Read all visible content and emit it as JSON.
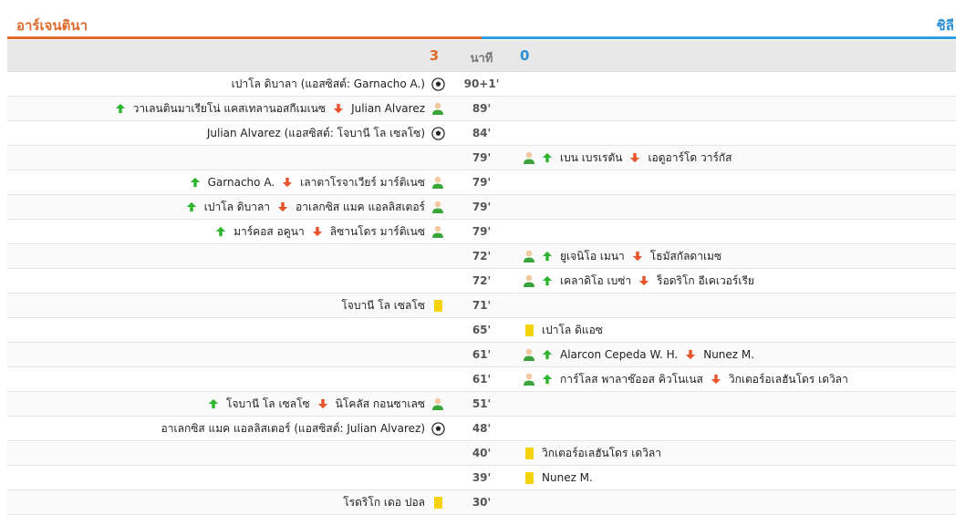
{
  "teams": {
    "home": "อาร์เจนตินา",
    "away": "ชิลี"
  },
  "score": {
    "home": "3",
    "away": "0"
  },
  "minute_header": "นาที",
  "colors": {
    "home": "#e06a2c",
    "away": "#2d8fd5",
    "arrow_in": "#2db52d",
    "arrow_out": "#e8532b",
    "card": "#f5d20a"
  },
  "events": [
    {
      "minute": "90+1'",
      "side": "home",
      "type": "goal",
      "text": "เปาโล ดิบาลา (แอสซิสต์: Garnacho A.)"
    },
    {
      "minute": "89'",
      "side": "home",
      "type": "sub",
      "in": "วาเลนตินมาเรียโน่ แคสเทลานอสกีเมเนซ",
      "out": "Julian Alvarez"
    },
    {
      "minute": "84'",
      "side": "home",
      "type": "goal",
      "text": "Julian Alvarez (แอสซิสต์: โจบานี โล เซลโซ)"
    },
    {
      "minute": "79'",
      "side": "away",
      "type": "sub",
      "in": "เบน เบรเรตัน",
      "out": "เอดูอาร์โด วาร์กัส"
    },
    {
      "minute": "79'",
      "side": "home",
      "type": "sub",
      "in": "Garnacho A.",
      "out": "เลาตาโรจาเวียร์ มาร์ติเนซ"
    },
    {
      "minute": "79'",
      "side": "home",
      "type": "sub",
      "in": "เปาโล ดิบาลา",
      "out": "อาเลกซิส แมค แอลลิสเตอร์"
    },
    {
      "minute": "79'",
      "side": "home",
      "type": "sub",
      "in": "มาร์คอส อคูนา",
      "out": "ลิซานโดร มาร์ติเนซ"
    },
    {
      "minute": "72'",
      "side": "away",
      "type": "sub",
      "in": "ยูเจนิโอ เมนา",
      "out": "โธมัสกัลดาเมซ"
    },
    {
      "minute": "72'",
      "side": "away",
      "type": "sub",
      "in": "เคลาดิโอ เบซ่า",
      "out": "ร็อดริโก อีเคเวอร์เรีย"
    },
    {
      "minute": "71'",
      "side": "home",
      "type": "yellow",
      "text": "โจบานี โล เซลโซ"
    },
    {
      "minute": "65'",
      "side": "away",
      "type": "yellow",
      "text": "เปาโล ดิแอซ"
    },
    {
      "minute": "61'",
      "side": "away",
      "type": "sub",
      "in": "Alarcon Cepeda W. H.",
      "out": "Nunez M."
    },
    {
      "minute": "61'",
      "side": "away",
      "type": "sub",
      "in": "การ์โลส พาลาซ๊ออส คิวโนเนส",
      "out": "วิกเตอร์อเลฮันโดร เดวิลา"
    },
    {
      "minute": "51'",
      "side": "home",
      "type": "sub",
      "in": "โจบานี โล เซลโซ",
      "out": "นิโคลัส กอนซาเลซ"
    },
    {
      "minute": "48'",
      "side": "home",
      "type": "goal",
      "text": "อาเลกซิส แมค แอลลิสเตอร์ (แอสซิสต์: Julian Alvarez)"
    },
    {
      "minute": "40'",
      "side": "away",
      "type": "yellow",
      "text": "วิกเตอร์อเลฮันโดร เดวิลา"
    },
    {
      "minute": "39'",
      "side": "away",
      "type": "yellow",
      "text": "Nunez M."
    },
    {
      "minute": "30'",
      "side": "home",
      "type": "yellow",
      "text": "โรดริโก เดอ ปอล"
    }
  ]
}
